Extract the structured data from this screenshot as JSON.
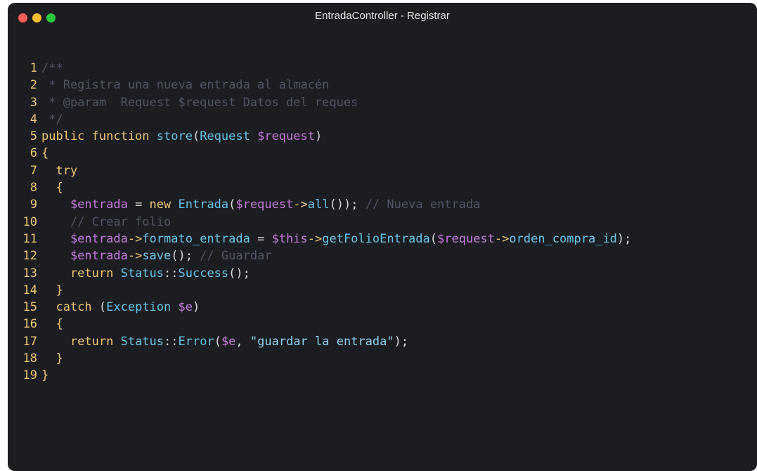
{
  "window": {
    "title": "EntradaController -  Registrar",
    "traffic_lights": [
      {
        "name": "close",
        "color": "#ff5f57"
      },
      {
        "name": "minimize",
        "color": "#febc2e"
      },
      {
        "name": "zoom",
        "color": "#28c840"
      }
    ]
  },
  "colors": {
    "background": "#1b1d21",
    "line_number": "#f0c674",
    "line_number_dim": "#d9b860",
    "comment": "#4f5563",
    "keyword": "#f0c674",
    "function": "#68c4e8",
    "variable": "#c678dd",
    "string": "#8ed1f0"
  },
  "code": {
    "lines": [
      {
        "n": "1",
        "tokens": [
          {
            "t": "/**",
            "c": "c-cmt"
          }
        ]
      },
      {
        "n": "2",
        "tokens": [
          {
            "t": " * Registra una nueva entrada al almacén",
            "c": "c-cmt"
          }
        ]
      },
      {
        "n": "3",
        "tokens": [
          {
            "t": " * @param  Request $request Datos del reques",
            "c": "c-cmt"
          }
        ]
      },
      {
        "n": "4",
        "tokens": [
          {
            "t": " */",
            "c": "c-cmt"
          }
        ]
      },
      {
        "n": "5",
        "tokens": [
          {
            "t": "public function ",
            "c": "c-kw"
          },
          {
            "t": "store",
            "c": "c-fn"
          },
          {
            "t": "(",
            "c": "c-pun"
          },
          {
            "t": "Request ",
            "c": "c-fn"
          },
          {
            "t": "$request",
            "c": "c-var"
          },
          {
            "t": ")",
            "c": "c-pun"
          }
        ]
      },
      {
        "n": "6",
        "tokens": [
          {
            "t": "{",
            "c": "c-brace"
          }
        ]
      },
      {
        "n": "7",
        "tokens": [
          {
            "t": "  try",
            "c": "c-kw"
          }
        ]
      },
      {
        "n": "8",
        "tokens": [
          {
            "t": "  {",
            "c": "c-brace"
          }
        ]
      },
      {
        "n": "9",
        "tokens": [
          {
            "t": "    $entrada",
            "c": "c-var"
          },
          {
            "t": " = ",
            "c": "c-pun"
          },
          {
            "t": "new ",
            "c": "c-kw"
          },
          {
            "t": "Entrada",
            "c": "c-fn"
          },
          {
            "t": "(",
            "c": "c-pun"
          },
          {
            "t": "$request",
            "c": "c-var"
          },
          {
            "t": "->",
            "c": "c-kw"
          },
          {
            "t": "all",
            "c": "c-fn"
          },
          {
            "t": "()); ",
            "c": "c-pun"
          },
          {
            "t": "// Nueva entrada",
            "c": "c-cmt"
          }
        ]
      },
      {
        "n": "10",
        "tokens": [
          {
            "t": "    // Crear folio",
            "c": "c-cmt"
          }
        ]
      },
      {
        "n": "11",
        "tokens": [
          {
            "t": "    $entrada",
            "c": "c-var"
          },
          {
            "t": "->",
            "c": "c-kw"
          },
          {
            "t": "formato_entrada",
            "c": "c-fn"
          },
          {
            "t": " = ",
            "c": "c-pun"
          },
          {
            "t": "$this",
            "c": "c-var"
          },
          {
            "t": "->",
            "c": "c-kw"
          },
          {
            "t": "getFolioEntrada",
            "c": "c-fn"
          },
          {
            "t": "(",
            "c": "c-pun"
          },
          {
            "t": "$request",
            "c": "c-var"
          },
          {
            "t": "->",
            "c": "c-kw"
          },
          {
            "t": "orden_compra_id",
            "c": "c-fn"
          },
          {
            "t": ");",
            "c": "c-pun"
          }
        ]
      },
      {
        "n": "12",
        "tokens": [
          {
            "t": "    $entrada",
            "c": "c-var"
          },
          {
            "t": "->",
            "c": "c-kw"
          },
          {
            "t": "save",
            "c": "c-fn"
          },
          {
            "t": "(); ",
            "c": "c-pun"
          },
          {
            "t": "// Guardar",
            "c": "c-cmt"
          }
        ]
      },
      {
        "n": "13",
        "tokens": [
          {
            "t": "    return ",
            "c": "c-kw"
          },
          {
            "t": "Status",
            "c": "c-fn"
          },
          {
            "t": "::",
            "c": "c-pun"
          },
          {
            "t": "Success",
            "c": "c-fn"
          },
          {
            "t": "();",
            "c": "c-pun"
          }
        ]
      },
      {
        "n": "14",
        "tokens": [
          {
            "t": "  }",
            "c": "c-brace"
          }
        ]
      },
      {
        "n": "15",
        "tokens": [
          {
            "t": "  catch ",
            "c": "c-kw"
          },
          {
            "t": "(",
            "c": "c-pun"
          },
          {
            "t": "Exception ",
            "c": "c-fn"
          },
          {
            "t": "$e",
            "c": "c-var"
          },
          {
            "t": ")",
            "c": "c-pun"
          }
        ]
      },
      {
        "n": "16",
        "tokens": [
          {
            "t": "  {",
            "c": "c-brace"
          }
        ]
      },
      {
        "n": "17",
        "tokens": [
          {
            "t": "    return ",
            "c": "c-kw"
          },
          {
            "t": "Status",
            "c": "c-fn"
          },
          {
            "t": "::",
            "c": "c-pun"
          },
          {
            "t": "Error",
            "c": "c-fn"
          },
          {
            "t": "(",
            "c": "c-pun"
          },
          {
            "t": "$e",
            "c": "c-var"
          },
          {
            "t": ", ",
            "c": "c-pun"
          },
          {
            "t": "\"guardar la entrada\"",
            "c": "c-str"
          },
          {
            "t": ");",
            "c": "c-pun"
          }
        ]
      },
      {
        "n": "18",
        "tokens": [
          {
            "t": "  }",
            "c": "c-brace"
          }
        ]
      },
      {
        "n": "19",
        "tokens": [
          {
            "t": "}",
            "c": "c-brace"
          }
        ]
      }
    ]
  }
}
